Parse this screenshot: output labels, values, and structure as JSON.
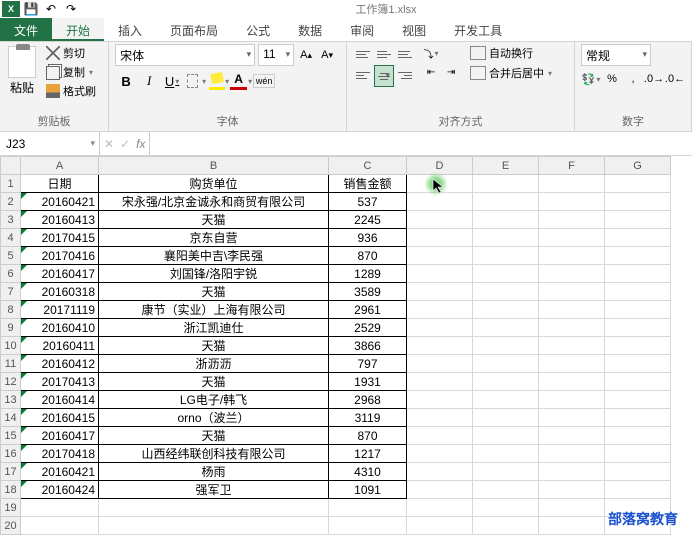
{
  "titlebar": {
    "title": "工作簿1.xlsx"
  },
  "tabs": {
    "file": "文件",
    "home": "开始",
    "insert": "插入",
    "layout": "页面布局",
    "formula": "公式",
    "data": "数据",
    "review": "审阅",
    "view": "视图",
    "dev": "开发工具"
  },
  "clipboard": {
    "paste": "粘贴",
    "cut": "剪切",
    "copy": "复制",
    "brush": "格式刷",
    "label": "剪贴板"
  },
  "font": {
    "name": "宋体",
    "size": "11",
    "wen": "wén",
    "label": "字体"
  },
  "align": {
    "wrap": "自动换行",
    "merge": "合并后居中",
    "label": "对齐方式"
  },
  "number": {
    "format": "常规",
    "label": "数字"
  },
  "namebox": "J23",
  "chart_data": {
    "type": "table",
    "headers": [
      "日期",
      "购货单位",
      "销售金额"
    ],
    "rows": [
      [
        "20160421",
        "宋永强/北京金诚永和商贸有限公司",
        "537"
      ],
      [
        "20160413",
        "天猫",
        "2245"
      ],
      [
        "20170415",
        "京东自营",
        "936"
      ],
      [
        "20170416",
        "襄阳美中吉\\李民强",
        "870"
      ],
      [
        "20160417",
        "刘国锋/洛阳宇锐",
        "1289"
      ],
      [
        "20160318",
        "天猫",
        "3589"
      ],
      [
        "20171119",
        "康节（实业）上海有限公司",
        "2961"
      ],
      [
        "20160410",
        "浙江凯迪仕",
        "2529"
      ],
      [
        "20160411",
        "天猫",
        "3866"
      ],
      [
        "20160412",
        "浙沥沥",
        "797"
      ],
      [
        "20170413",
        "天猫",
        "1931"
      ],
      [
        "20160414",
        "LG电子/韩飞",
        "2968"
      ],
      [
        "20160415",
        "orno（波兰）",
        "3119"
      ],
      [
        "20160417",
        "天猫",
        "870"
      ],
      [
        "20170418",
        "山西经纬联创科技有限公司",
        "1217"
      ],
      [
        "20160421",
        "杨雨",
        "4310"
      ],
      [
        "20160424",
        "强军卫",
        "1091"
      ]
    ]
  },
  "cols": [
    "A",
    "B",
    "C",
    "D",
    "E",
    "F",
    "G"
  ],
  "watermark": "部落窝教育"
}
